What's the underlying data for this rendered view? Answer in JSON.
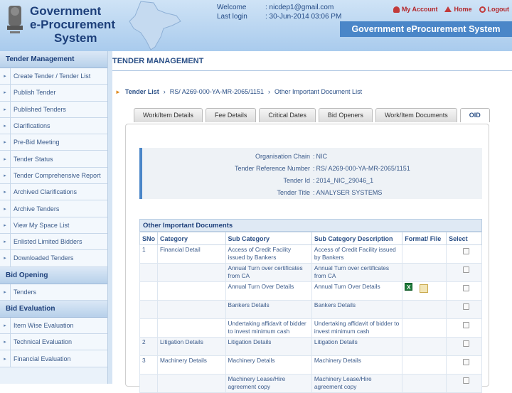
{
  "header": {
    "logo_line1": "Government",
    "logo_line2": "e-Procurement",
    "logo_line3": "System",
    "welcome_label": "Welcome",
    "welcome_value": ": nicdep1@gmail.com",
    "lastlogin_label": "Last login",
    "lastlogin_value": ": 30-Jun-2014 03:06 PM",
    "nav": [
      {
        "label": "My Account",
        "icon": "user-icon"
      },
      {
        "label": "Home",
        "icon": "home-icon"
      },
      {
        "label": "Logout",
        "icon": "logout-icon"
      }
    ],
    "banner": "Government eProcurement System",
    "colors": {
      "header_bg": "#b8d4ef",
      "banner": "#4a86c8",
      "nav": "#b3262a"
    }
  },
  "sidebar": {
    "sections": [
      {
        "title": "Tender Management",
        "items": [
          "Create Tender / Tender List",
          "Publish Tender",
          "Published Tenders",
          "Clarifications",
          "Pre-Bid Meeting",
          "Tender Status",
          "Tender Comprehensive Report",
          "Archived Clarifications",
          "Archive Tenders",
          "View My Space List",
          "Enlisted Limited Bidders",
          "Downloaded Tenders"
        ]
      },
      {
        "title": "Bid Opening",
        "items": [
          "Tenders"
        ]
      },
      {
        "title": "Bid Evaluation",
        "items": [
          "Item Wise Evaluation",
          "Technical Evaluation",
          "Financial Evaluation"
        ]
      }
    ]
  },
  "main": {
    "title": "TENDER MANAGEMENT",
    "breadcrumb": {
      "root": "Tender List",
      "ref": "RS/ A269-000-YA-MR-2065/1151",
      "current": "Other Important Document List"
    },
    "tabs": [
      "Work/Item Details",
      "Fee Details",
      "Critical Dates",
      "Bid Openers",
      "Work/Item Documents",
      "OID"
    ],
    "active_tab": "OID",
    "info": [
      {
        "label": "Organisation Chain",
        "value": "NIC"
      },
      {
        "label": "Tender Reference Number",
        "value": "RS/ A269-000-YA-MR-2065/1151"
      },
      {
        "label": "Tender Id",
        "value": "2014_NIC_29046_1"
      },
      {
        "label": "Tender Title",
        "value": "ANALYSER SYSTEMS"
      }
    ],
    "oid": {
      "title": "Other Important Documents",
      "columns": [
        "SNo",
        "Category",
        "Sub Category",
        "Sub Category Description",
        "Format/ File",
        "Select"
      ],
      "rows": [
        {
          "sno": "1",
          "cat": "Financial Detail",
          "sub": "Access of Credit Facility issued by Bankers",
          "desc": "Access of Credit Facility issued by Bankers",
          "file": ""
        },
        {
          "sno": "",
          "cat": "",
          "sub": "Annual Turn over certificates from CA",
          "desc": "Annual Turn over certificates from CA",
          "file": ""
        },
        {
          "sno": "",
          "cat": "",
          "sub": "Annual Turn Over Details",
          "desc": "Annual Turn Over Details",
          "file": "xls"
        },
        {
          "sno": "",
          "cat": "",
          "sub": "Bankers Details",
          "desc": "Bankers Details",
          "file": ""
        },
        {
          "sno": "",
          "cat": "",
          "sub": "Undertaking affidavit of bidder to invest minimum cash",
          "desc": "Undertaking affidavit of bidder to invest minimum cash",
          "file": ""
        },
        {
          "sno": "2",
          "cat": "Litigation Details",
          "sub": "Litigation Details",
          "desc": "Litigation Details",
          "file": ""
        },
        {
          "sno": "3",
          "cat": "Machinery Details",
          "sub": "Machinery Details",
          "desc": "Machinery Details",
          "file": ""
        },
        {
          "sno": "",
          "cat": "",
          "sub": "Machinery Lease/Hire agreement copy",
          "desc": "Machinery Lease/Hire agreement copy",
          "file": ""
        }
      ]
    }
  }
}
